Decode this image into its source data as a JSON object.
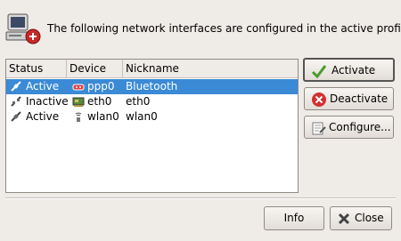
{
  "header": {
    "icon": "network-computer-icon",
    "text": "The following network interfaces are configured in the active profile."
  },
  "table": {
    "columns": [
      "Status",
      "Device",
      "Nickname"
    ],
    "rows": [
      {
        "status": "Active",
        "status_icon": "connected-plug-icon",
        "device": "ppp0",
        "device_icon": "modem-icon",
        "nickname": "Bluetooth",
        "selected": true
      },
      {
        "status": "Inactive",
        "status_icon": "disconnected-plug-icon",
        "device": "eth0",
        "device_icon": "ethernet-card-icon",
        "nickname": "eth0",
        "selected": false
      },
      {
        "status": "Active",
        "status_icon": "connected-plug-icon",
        "device": "wlan0",
        "device_icon": "wireless-icon",
        "nickname": "wlan0",
        "selected": false
      }
    ]
  },
  "buttons": {
    "activate": "Activate",
    "deactivate": "Deactivate",
    "configure": "Configure...",
    "info": "Info",
    "close": "Close"
  },
  "colors": {
    "selection": "#3a8ad6",
    "background": "#efebe7"
  }
}
